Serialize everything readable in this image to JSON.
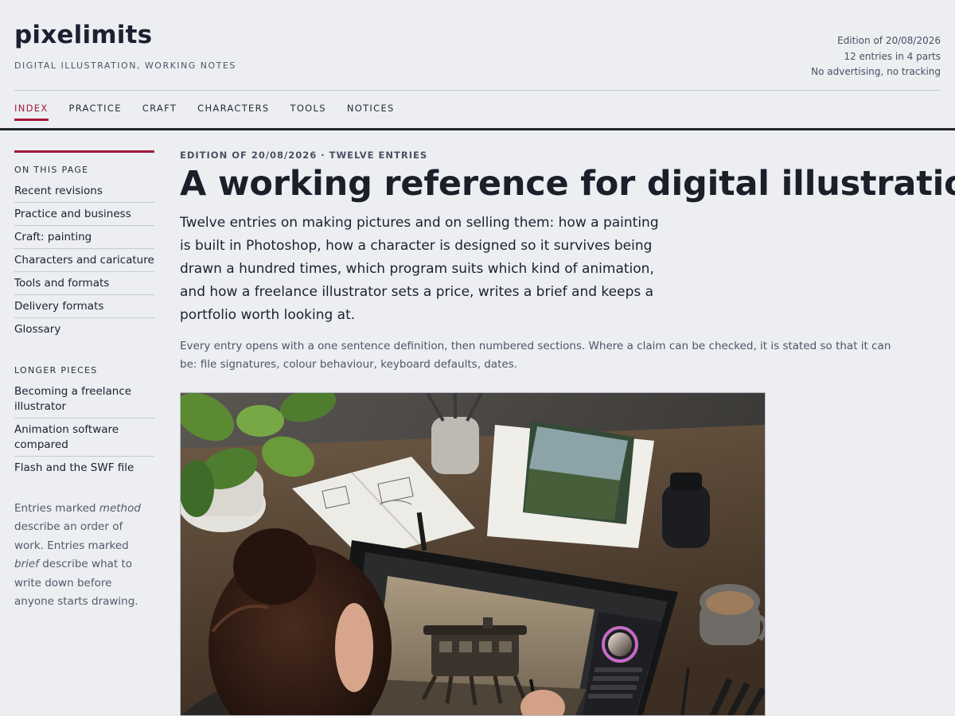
{
  "header": {
    "site_title": "pixelimits",
    "tagline": "DIGITAL ILLUSTRATION, WORKING NOTES",
    "meta": [
      "Edition of 20/08/2026",
      "12 entries in 4 parts",
      "No advertising, no tracking"
    ]
  },
  "nav": [
    {
      "label": "INDEX",
      "active": true
    },
    {
      "label": "PRACTICE"
    },
    {
      "label": "CRAFT"
    },
    {
      "label": "CHARACTERS"
    },
    {
      "label": "TOOLS"
    },
    {
      "label": "NOTICES"
    }
  ],
  "sidebar": {
    "on_this_page_heading": "ON THIS PAGE",
    "on_this_page": [
      "Recent revisions",
      "Practice and business",
      "Craft: painting",
      "Characters and caricature",
      "Tools and formats",
      "Delivery formats",
      "Glossary"
    ],
    "longer_pieces_heading": "LONGER PIECES",
    "longer_pieces": [
      "Becoming a freelance illustrator",
      "Animation software compared",
      "Flash and the SWF file"
    ],
    "note": {
      "part1": "Entries marked ",
      "term1": "method",
      "part2": " describe an order of work. Entries marked ",
      "term2": "brief",
      "part3": " describe what to write down before anyone starts drawing."
    }
  },
  "main": {
    "kicker": "EDITION OF 20/08/2026 · TWELVE ENTRIES",
    "headline": "A working reference for digital illustration",
    "lede": "Twelve entries on making pictures and on selling them: how a painting is built in Photoshop, how a character is designed so it survives being drawn a hundred times, which program suits which kind of animation, and how a freelance illustrator sets a price, writes a brief and keeps a portfolio worth looking at.",
    "dek": "Every entry opens with a one sentence definition, then numbered sections. Where a claim can be checked, it is stated so that it can be: file signatures, colour behaviour, keyboard defaults, dates."
  },
  "colors": {
    "accent": "#a3193b",
    "background": "#eceef2",
    "text": "#1b1f2a"
  }
}
